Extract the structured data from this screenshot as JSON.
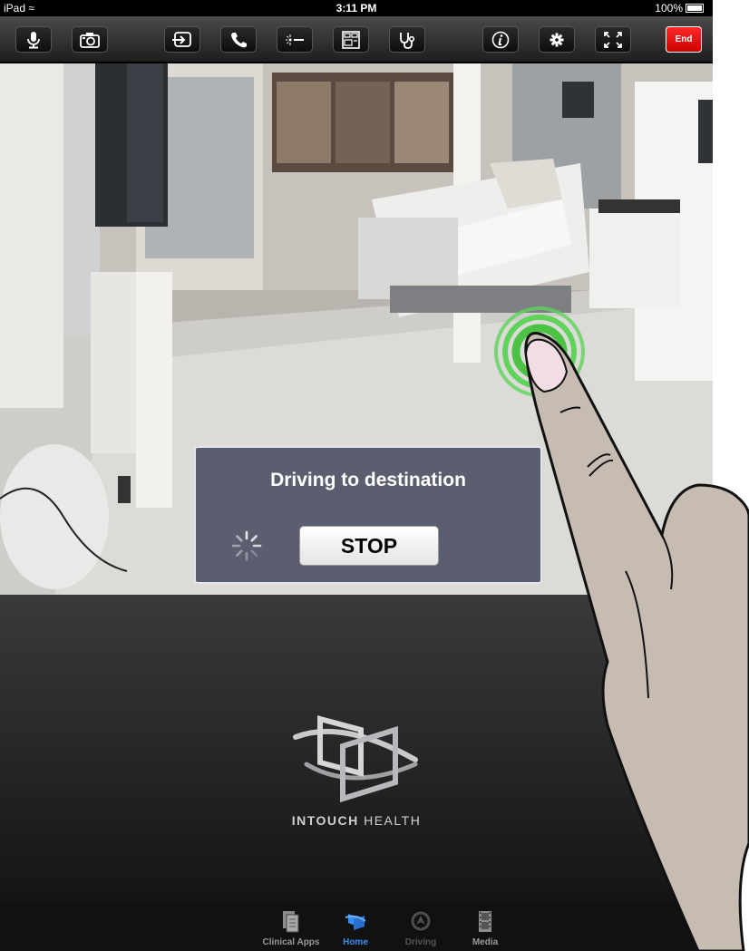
{
  "status_bar": {
    "device": "iPad",
    "time": "3:11 PM",
    "battery": "100%"
  },
  "toolbar": {
    "buttons": [
      "microphone-icon",
      "camera-icon",
      "input-switch-icon",
      "phone-icon",
      "laser-pointer-icon",
      "monitor-layout-icon",
      "stethoscope-icon",
      "info-icon",
      "settings-icon",
      "fullscreen-icon"
    ],
    "end_label": "End"
  },
  "dialog": {
    "title": "Driving to destination",
    "stop_label": "STOP"
  },
  "brand": {
    "bold": "INTOUCH",
    "light": " HEALTH"
  },
  "tabs": [
    {
      "label": "Clinical Apps",
      "state": "normal"
    },
    {
      "label": "Home",
      "state": "active"
    },
    {
      "label": "Driving",
      "state": "disabled"
    },
    {
      "label": "Media",
      "state": "normal"
    }
  ],
  "colors": {
    "accent": "#3a8cf0",
    "end_button": "#e60000",
    "touch_ring": "#5fd35a"
  }
}
